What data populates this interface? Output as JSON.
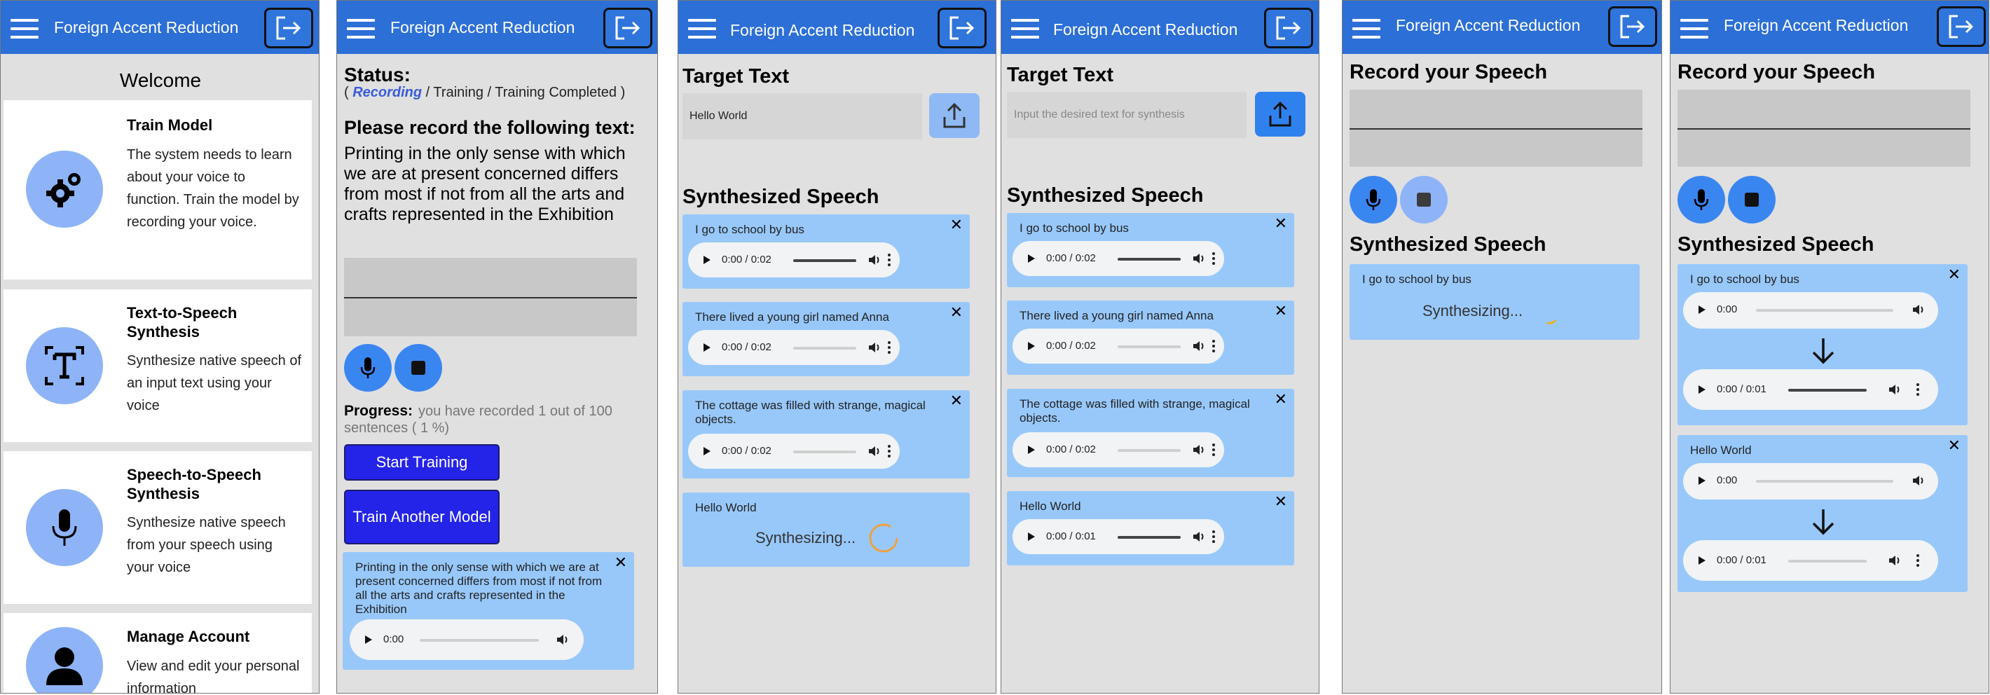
{
  "app": {
    "title": "Foreign Accent Reduction"
  },
  "icons": {
    "menu": "hamburger-menu-icon",
    "logout": "logout-icon",
    "upload": "upload-icon",
    "mic": "microphone-icon",
    "stop": "stop-icon",
    "close": "close-icon",
    "play": "play-icon",
    "volume": "volume-icon",
    "more": "more-options-icon",
    "arrow": "arrow-down-icon",
    "spinner": "loading-spinner-icon"
  },
  "colors": {
    "header": "#2c6fd6",
    "result_box": "#98c8fa",
    "primary_button": "#2424e8",
    "recording_status": "#3a5bd9",
    "spinner": "#f0a040"
  },
  "screen1": {
    "welcome": "Welcome",
    "cards": [
      {
        "title": "Train Model",
        "desc": "The system needs to learn about your voice to function. Train the model by recording your voice.",
        "icon": "gear-icon"
      },
      {
        "title": "Text-to-Speech Synthesis",
        "desc": "Synthesize native speech of an input text using your voice",
        "icon": "text-icon"
      },
      {
        "title": "Speech-to-Speech Synthesis",
        "desc": "Synthesize native speech from your speech using your voice",
        "icon": "microphone-icon"
      },
      {
        "title": "Manage Account",
        "desc": "View and edit your personal information",
        "icon": "user-icon"
      }
    ]
  },
  "screen2": {
    "status_label": "Status:",
    "status_open": "( ",
    "status_active": "Recording",
    "status_rest": " / Training / Training Completed )",
    "prompt_heading": "Please record the following text:",
    "prompt_text": "Printing in the only sense with which we are at present concerned differs from most if not from all the arts and crafts represented in the Exhibition",
    "progress_label": "Progress:",
    "progress_text": "you have recorded 1 out of 100 sentences ( 1 %)",
    "progress_recorded": 1,
    "progress_total": 100,
    "start_button": "Start Training",
    "train_another_button": "Train Another Model",
    "recording_text": "Printing in the only sense with which we are at present concerned differs from most if not from all the arts and crafts represented in the Exhibition",
    "recording_time": "0:00"
  },
  "screen3": {
    "target_heading": "Target Text",
    "target_value": "Hello World",
    "synth_heading": "Synthesized Speech",
    "results": [
      {
        "text": "I go to school by bus",
        "time": "0:00 / 0:02"
      },
      {
        "text": "There lived a young girl named Anna",
        "time": "0:00 / 0:02"
      },
      {
        "text": "The cottage was filled with strange, magical objects.",
        "time": "0:00 / 0:02"
      }
    ],
    "pending": {
      "text": "Hello World",
      "status": "Synthesizing..."
    }
  },
  "screen4": {
    "target_heading": "Target Text",
    "target_placeholder": "Input the desired text for synthesis",
    "synth_heading": "Synthesized Speech",
    "results": [
      {
        "text": "I go to school by bus",
        "time": "0:00 / 0:02"
      },
      {
        "text": "There lived a young girl named Anna",
        "time": "0:00 / 0:02"
      },
      {
        "text": "The cottage was filled with strange, magical objects.",
        "time": "0:00 / 0:02"
      },
      {
        "text": "Hello World",
        "time": "0:00 / 0:01"
      }
    ]
  },
  "screen5": {
    "record_heading": "Record your Speech",
    "synth_heading": "Synthesized Speech",
    "pending": {
      "text": "I go to school by bus",
      "status": "Synthesizing..."
    }
  },
  "screen6": {
    "record_heading": "Record your Speech",
    "synth_heading": "Synthesized Speech",
    "results": [
      {
        "text": "I go to school by bus",
        "input_time": "0:00",
        "output_time": "0:00 / 0:01"
      },
      {
        "text": "Hello World",
        "input_time": "0:00",
        "output_time": "0:00 / 0:01"
      }
    ]
  }
}
